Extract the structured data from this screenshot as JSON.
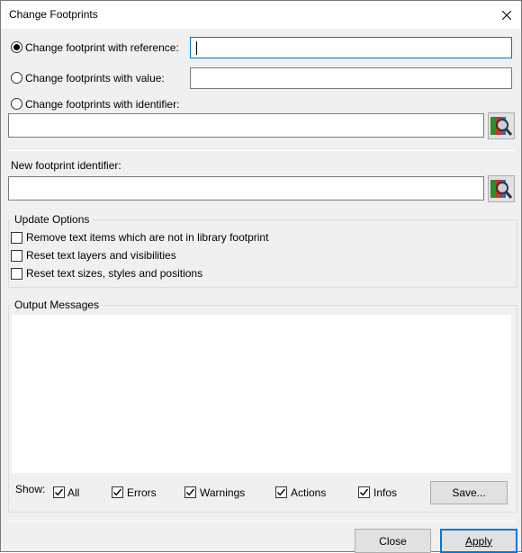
{
  "window": {
    "title": "Change Footprints"
  },
  "target": {
    "reference_label": "Change footprint with reference:",
    "value_label": "Change footprints with value:",
    "identifier_label": "Change footprints with identifier:",
    "reference_value": "",
    "value_value": "",
    "identifier_value": "",
    "selected": "reference"
  },
  "new_footprint": {
    "label": "New footprint identifier:",
    "value": ""
  },
  "update_options": {
    "title": "Update Options",
    "items": [
      {
        "label": "Remove text items which are not in library footprint",
        "checked": false
      },
      {
        "label": "Reset text layers and visibilities",
        "checked": false
      },
      {
        "label": "Reset text sizes, styles and positions",
        "checked": false
      }
    ]
  },
  "output": {
    "title": "Output Messages",
    "show_label": "Show:",
    "filters": [
      {
        "label": "All",
        "checked": true
      },
      {
        "label": "Errors",
        "checked": true
      },
      {
        "label": "Warnings",
        "checked": true
      },
      {
        "label": "Actions",
        "checked": true
      },
      {
        "label": "Infos",
        "checked": true
      }
    ],
    "save_label": "Save..."
  },
  "footer": {
    "close_label": "Close",
    "apply_label": "Apply"
  },
  "icons": {
    "close": "close-icon",
    "browse": "footprint-library-browser-icon"
  },
  "colors": {
    "accent": "#0078d7",
    "face": "#f0f0f0"
  }
}
